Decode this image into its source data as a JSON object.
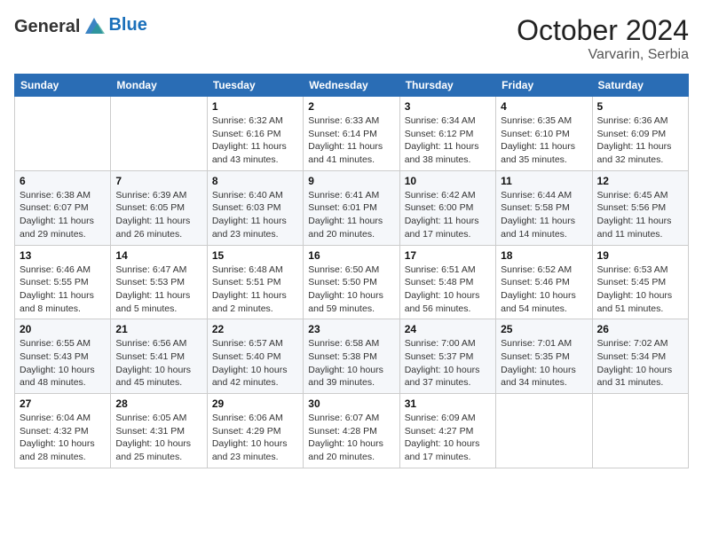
{
  "header": {
    "logo": {
      "text_general": "General",
      "text_blue": "Blue"
    },
    "month": "October 2024",
    "location": "Varvarin, Serbia"
  },
  "days_of_week": [
    "Sunday",
    "Monday",
    "Tuesday",
    "Wednesday",
    "Thursday",
    "Friday",
    "Saturday"
  ],
  "weeks": [
    [
      {
        "day": null
      },
      {
        "day": null
      },
      {
        "day": "1",
        "sunrise": "6:32 AM",
        "sunset": "6:16 PM",
        "daylight": "11 hours and 43 minutes."
      },
      {
        "day": "2",
        "sunrise": "6:33 AM",
        "sunset": "6:14 PM",
        "daylight": "11 hours and 41 minutes."
      },
      {
        "day": "3",
        "sunrise": "6:34 AM",
        "sunset": "6:12 PM",
        "daylight": "11 hours and 38 minutes."
      },
      {
        "day": "4",
        "sunrise": "6:35 AM",
        "sunset": "6:10 PM",
        "daylight": "11 hours and 35 minutes."
      },
      {
        "day": "5",
        "sunrise": "6:36 AM",
        "sunset": "6:09 PM",
        "daylight": "11 hours and 32 minutes."
      }
    ],
    [
      {
        "day": "6",
        "sunrise": "6:38 AM",
        "sunset": "6:07 PM",
        "daylight": "11 hours and 29 minutes."
      },
      {
        "day": "7",
        "sunrise": "6:39 AM",
        "sunset": "6:05 PM",
        "daylight": "11 hours and 26 minutes."
      },
      {
        "day": "8",
        "sunrise": "6:40 AM",
        "sunset": "6:03 PM",
        "daylight": "11 hours and 23 minutes."
      },
      {
        "day": "9",
        "sunrise": "6:41 AM",
        "sunset": "6:01 PM",
        "daylight": "11 hours and 20 minutes."
      },
      {
        "day": "10",
        "sunrise": "6:42 AM",
        "sunset": "6:00 PM",
        "daylight": "11 hours and 17 minutes."
      },
      {
        "day": "11",
        "sunrise": "6:44 AM",
        "sunset": "5:58 PM",
        "daylight": "11 hours and 14 minutes."
      },
      {
        "day": "12",
        "sunrise": "6:45 AM",
        "sunset": "5:56 PM",
        "daylight": "11 hours and 11 minutes."
      }
    ],
    [
      {
        "day": "13",
        "sunrise": "6:46 AM",
        "sunset": "5:55 PM",
        "daylight": "11 hours and 8 minutes."
      },
      {
        "day": "14",
        "sunrise": "6:47 AM",
        "sunset": "5:53 PM",
        "daylight": "11 hours and 5 minutes."
      },
      {
        "day": "15",
        "sunrise": "6:48 AM",
        "sunset": "5:51 PM",
        "daylight": "11 hours and 2 minutes."
      },
      {
        "day": "16",
        "sunrise": "6:50 AM",
        "sunset": "5:50 PM",
        "daylight": "10 hours and 59 minutes."
      },
      {
        "day": "17",
        "sunrise": "6:51 AM",
        "sunset": "5:48 PM",
        "daylight": "10 hours and 56 minutes."
      },
      {
        "day": "18",
        "sunrise": "6:52 AM",
        "sunset": "5:46 PM",
        "daylight": "10 hours and 54 minutes."
      },
      {
        "day": "19",
        "sunrise": "6:53 AM",
        "sunset": "5:45 PM",
        "daylight": "10 hours and 51 minutes."
      }
    ],
    [
      {
        "day": "20",
        "sunrise": "6:55 AM",
        "sunset": "5:43 PM",
        "daylight": "10 hours and 48 minutes."
      },
      {
        "day": "21",
        "sunrise": "6:56 AM",
        "sunset": "5:41 PM",
        "daylight": "10 hours and 45 minutes."
      },
      {
        "day": "22",
        "sunrise": "6:57 AM",
        "sunset": "5:40 PM",
        "daylight": "10 hours and 42 minutes."
      },
      {
        "day": "23",
        "sunrise": "6:58 AM",
        "sunset": "5:38 PM",
        "daylight": "10 hours and 39 minutes."
      },
      {
        "day": "24",
        "sunrise": "7:00 AM",
        "sunset": "5:37 PM",
        "daylight": "10 hours and 37 minutes."
      },
      {
        "day": "25",
        "sunrise": "7:01 AM",
        "sunset": "5:35 PM",
        "daylight": "10 hours and 34 minutes."
      },
      {
        "day": "26",
        "sunrise": "7:02 AM",
        "sunset": "5:34 PM",
        "daylight": "10 hours and 31 minutes."
      }
    ],
    [
      {
        "day": "27",
        "sunrise": "6:04 AM",
        "sunset": "4:32 PM",
        "daylight": "10 hours and 28 minutes."
      },
      {
        "day": "28",
        "sunrise": "6:05 AM",
        "sunset": "4:31 PM",
        "daylight": "10 hours and 25 minutes."
      },
      {
        "day": "29",
        "sunrise": "6:06 AM",
        "sunset": "4:29 PM",
        "daylight": "10 hours and 23 minutes."
      },
      {
        "day": "30",
        "sunrise": "6:07 AM",
        "sunset": "4:28 PM",
        "daylight": "10 hours and 20 minutes."
      },
      {
        "day": "31",
        "sunrise": "6:09 AM",
        "sunset": "4:27 PM",
        "daylight": "10 hours and 17 minutes."
      },
      {
        "day": null
      },
      {
        "day": null
      }
    ]
  ],
  "labels": {
    "sunrise": "Sunrise: ",
    "sunset": "Sunset: ",
    "daylight": "Daylight: "
  }
}
